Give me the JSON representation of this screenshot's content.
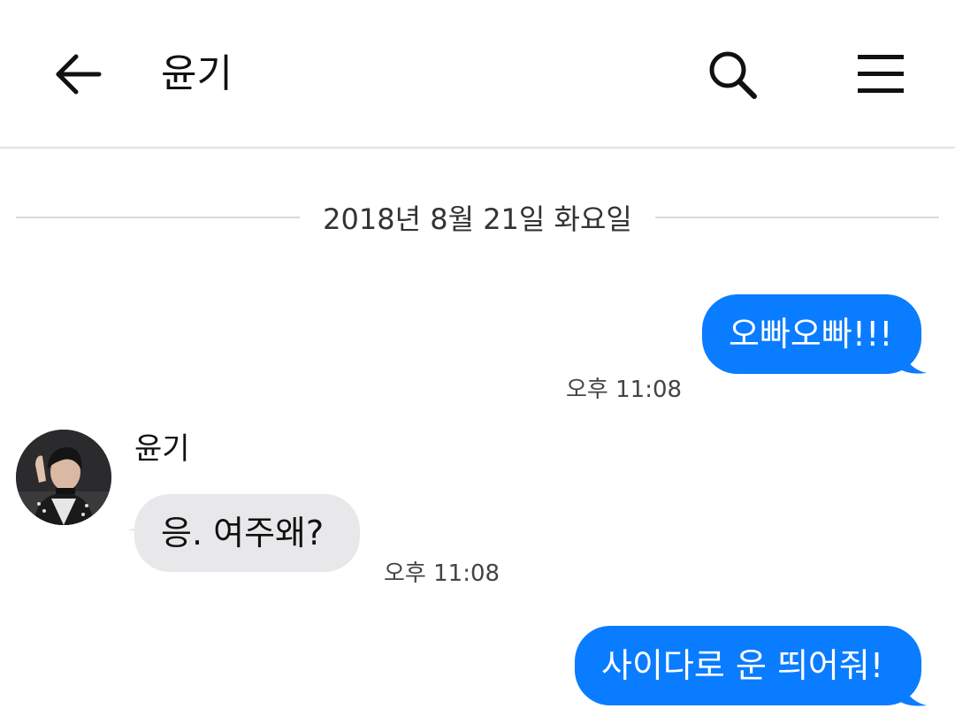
{
  "header": {
    "title": "윤기",
    "back_icon": "arrow-left-icon",
    "search_icon": "search-icon",
    "menu_icon": "hamburger-menu-icon"
  },
  "date_separator": "2018년 8월 21일 화요일",
  "messages": [
    {
      "sender": "me",
      "text": "오빠오빠!!!",
      "time": "오후 11:08"
    },
    {
      "sender": "them",
      "name": "윤기",
      "text": "응. 여주왜?",
      "time": "오후 11:08"
    },
    {
      "sender": "me",
      "text": "사이다로 운 띄어줘!",
      "time": ""
    }
  ],
  "colors": {
    "my_bubble": "#0a7cff",
    "their_bubble": "#e8e8ea",
    "divider": "#e2e2e2"
  }
}
